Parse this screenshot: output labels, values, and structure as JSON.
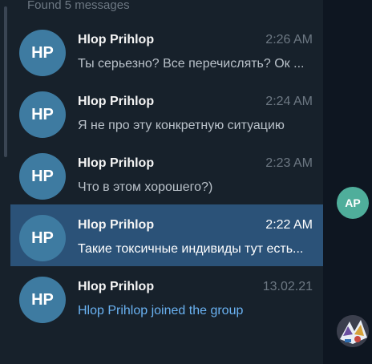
{
  "search": {
    "found_label": "Found 5 messages"
  },
  "results": [
    {
      "initials": "HP",
      "sender": "Hlop Prihlop",
      "time": "2:26 AM",
      "text": "Ты серьезно? Все перечислять? Ок ...",
      "selected": false,
      "service": false
    },
    {
      "initials": "HP",
      "sender": "Hlop Prihlop",
      "time": "2:24 AM",
      "text": "Я не про эту конкретную ситуацию",
      "selected": false,
      "service": false
    },
    {
      "initials": "HP",
      "sender": "Hlop Prihlop",
      "time": "2:23 AM",
      "text": "Что в этом хорошего?)",
      "selected": false,
      "service": false
    },
    {
      "initials": "HP",
      "sender": "Hlop Prihlop",
      "time": "2:22 AM",
      "text": "Такие токсичные индивиды тут есть...",
      "selected": true,
      "service": false
    },
    {
      "initials": "HP",
      "sender": "Hlop Prihlop",
      "time": "13.02.21",
      "text": "Hlop Prihlop joined the group",
      "selected": false,
      "service": true
    }
  ],
  "chat": {
    "avatar_initials": "AP"
  },
  "colors": {
    "panel_bg": "#17212b",
    "chat_bg": "#0e1621",
    "selected_bg": "#2b5278",
    "avatar_hp": "#3e7ba1",
    "avatar_ap": "#4fae9b",
    "service_text": "#6ab2f2"
  }
}
